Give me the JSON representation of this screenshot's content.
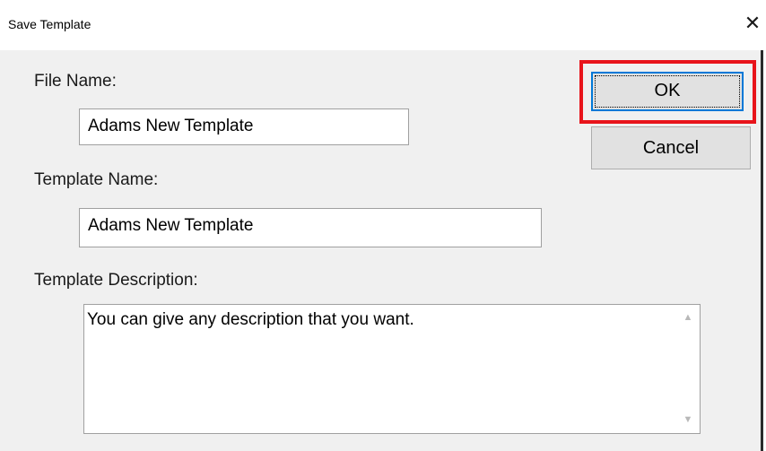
{
  "dialog": {
    "title": "Save Template",
    "close_glyph": "✕"
  },
  "form": {
    "file_name_label": "File Name:",
    "file_name_value": "Adams New Template",
    "template_name_label": "Template Name:",
    "template_name_value": "Adams New Template",
    "template_description_label": "Template Description:",
    "template_description_value": "You can give any description that you want."
  },
  "buttons": {
    "ok_label": "OK",
    "cancel_label": "Cancel"
  },
  "annotation": {
    "highlight_color": "#e8141b",
    "highlighted_element": "ok-button"
  },
  "icons": {
    "close": "close-icon",
    "scroll_up": "scroll-up-arrow-icon",
    "scroll_down": "scroll-down-arrow-icon"
  }
}
